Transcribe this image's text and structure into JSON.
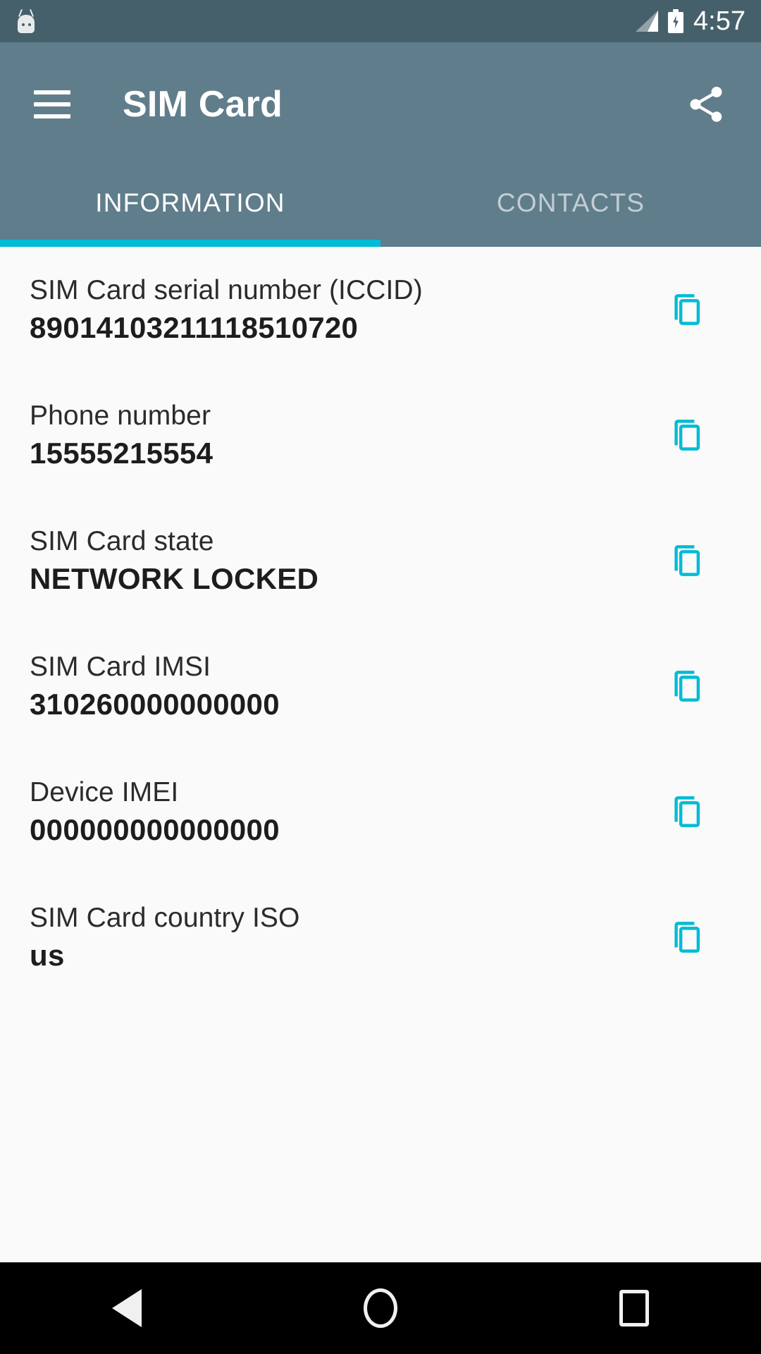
{
  "status_bar": {
    "notification_icon": "android-mascot-icon",
    "signal_icon": "signal-bars-icon",
    "battery_icon": "battery-charging-icon",
    "time": "4:57",
    "background_color": "#46606b"
  },
  "app_bar": {
    "menu_icon": "hamburger-menu-icon",
    "title": "SIM Card",
    "share_icon": "share-icon",
    "background_color": "#607d8b"
  },
  "tabs": {
    "items": [
      {
        "label": "INFORMATION",
        "active": true
      },
      {
        "label": "CONTACTS",
        "active": false
      }
    ],
    "indicator_color": "#00bcd4"
  },
  "info_list": {
    "copy_icon": "copy-icon",
    "copy_icon_color": "#00bcd4",
    "rows": [
      {
        "label": "SIM Card serial number (ICCID)",
        "value": "89014103211118510720"
      },
      {
        "label": "Phone number",
        "value": "15555215554"
      },
      {
        "label": "SIM Card state",
        "value": "NETWORK LOCKED"
      },
      {
        "label": "SIM Card IMSI",
        "value": "310260000000000"
      },
      {
        "label": "Device IMEI",
        "value": "000000000000000"
      },
      {
        "label": "SIM Card country ISO",
        "value": "us"
      }
    ]
  },
  "nav_bar": {
    "back_icon": "back-triangle-icon",
    "home_icon": "home-circle-icon",
    "recents_icon": "recents-square-icon",
    "background_color": "#000000"
  }
}
